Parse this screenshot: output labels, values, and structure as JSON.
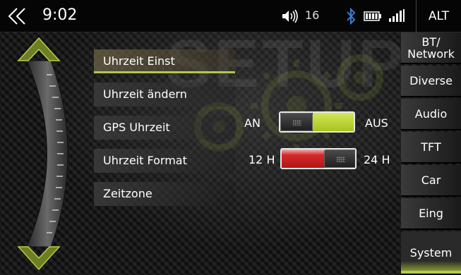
{
  "status_bar": {
    "time": "9:02",
    "volume": "16",
    "alt_label": "ALT",
    "icons": [
      "back-chevron-icon",
      "volume-icon",
      "bluetooth-icon",
      "battery-icon",
      "signal-icon"
    ]
  },
  "watermark": "SETUP",
  "menu": {
    "items": [
      {
        "label": "Uhrzeit Einst",
        "selected": true
      },
      {
        "label": "Uhrzeit ändern",
        "selected": false
      },
      {
        "label": "GPS Uhrzeit",
        "selected": false
      },
      {
        "label": "Uhrzeit Format",
        "selected": false
      },
      {
        "label": "Zeitzone",
        "selected": false
      }
    ]
  },
  "gps_toggle": {
    "left_label": "AN",
    "right_label": "AUS",
    "state": "AUS",
    "on_color": "#b6d12e"
  },
  "format_toggle": {
    "left_label": "12 H",
    "right_label": "24 H",
    "state": "24 H",
    "fill_color": "#c41a1a"
  },
  "sidebar": {
    "tabs": [
      {
        "label": "BT/\nNetwork",
        "active": false
      },
      {
        "label": "Diverse",
        "active": false
      },
      {
        "label": "Audio",
        "active": false
      },
      {
        "label": "TFT",
        "active": false
      },
      {
        "label": "Car",
        "active": false
      },
      {
        "label": "Eing",
        "active": false
      },
      {
        "label": "System",
        "active": true
      }
    ]
  },
  "colors": {
    "accent": "#b7cc45",
    "bluetooth": "#3a7bd5",
    "background": "#111111"
  }
}
